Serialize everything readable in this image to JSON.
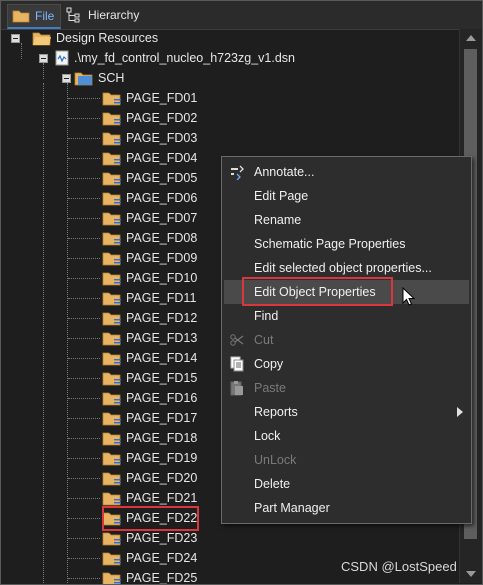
{
  "tabs": [
    {
      "label": "File",
      "active": true,
      "icon": "folder-icon"
    },
    {
      "label": "Hierarchy",
      "active": false,
      "icon": "hierarchy-icon"
    }
  ],
  "tree": {
    "root_label": "Design Resources",
    "design_label": ".\\my_fd_control_nucleo_h723zg_v1.dsn",
    "sch_label": "SCH",
    "pages": [
      "PAGE_FD01",
      "PAGE_FD02",
      "PAGE_FD03",
      "PAGE_FD04",
      "PAGE_FD05",
      "PAGE_FD06",
      "PAGE_FD07",
      "PAGE_FD08",
      "PAGE_FD09",
      "PAGE_FD10",
      "PAGE_FD11",
      "PAGE_FD12",
      "PAGE_FD13",
      "PAGE_FD14",
      "PAGE_FD15",
      "PAGE_FD16",
      "PAGE_FD17",
      "PAGE_FD18",
      "PAGE_FD19",
      "PAGE_FD20",
      "PAGE_FD21",
      "PAGE_FD22",
      "PAGE_FD23",
      "PAGE_FD24",
      "PAGE_FD25"
    ],
    "selected_page": "PAGE_FD22"
  },
  "context_menu": {
    "items": [
      {
        "label": "Annotate...",
        "icon": "annotate-icon",
        "enabled": true
      },
      {
        "label": "Edit Page",
        "enabled": true
      },
      {
        "label": "Rename",
        "enabled": true
      },
      {
        "label": "Schematic Page Properties",
        "enabled": true
      },
      {
        "label": "Edit selected object properties...",
        "enabled": true
      },
      {
        "label": "Edit Object Properties",
        "enabled": true,
        "highlighted": true
      },
      {
        "label": "Find",
        "enabled": true
      },
      {
        "label": "Cut",
        "icon": "scissors-icon",
        "enabled": false
      },
      {
        "label": "Copy",
        "icon": "copy-icon",
        "enabled": true
      },
      {
        "label": "Paste",
        "icon": "paste-icon",
        "enabled": false
      },
      {
        "label": "Reports",
        "enabled": true,
        "submenu": true
      },
      {
        "label": "Lock",
        "enabled": true
      },
      {
        "label": "UnLock",
        "enabled": false
      },
      {
        "label": "Delete",
        "enabled": true
      },
      {
        "label": "Part Manager",
        "enabled": true
      }
    ]
  },
  "watermark": "CSDN @LostSpeed",
  "colors": {
    "highlight_box": "#d9363e",
    "active_tab_text": "#7ab7ff",
    "folder": "#e8b463"
  }
}
